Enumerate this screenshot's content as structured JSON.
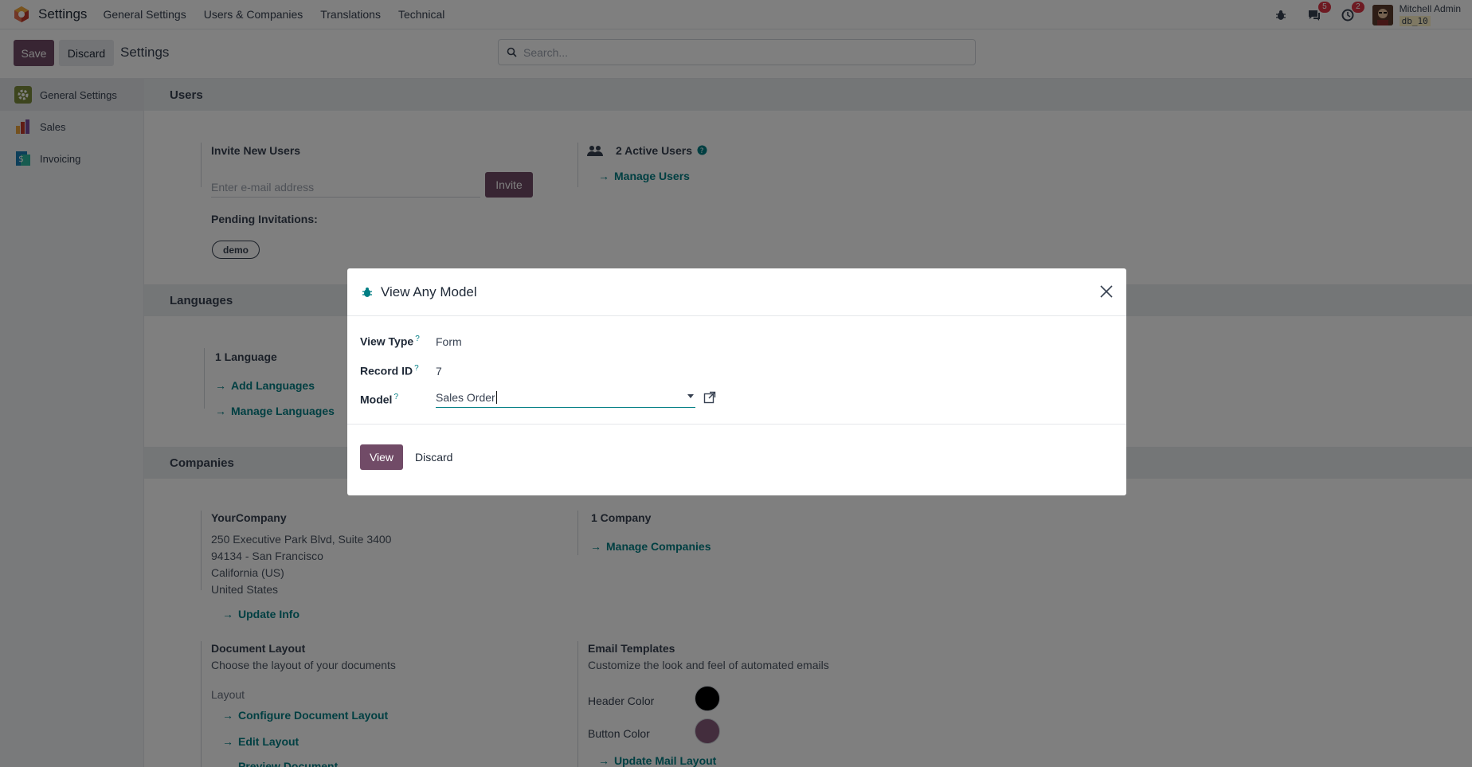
{
  "navbar": {
    "brand": "Settings",
    "menu": [
      "General Settings",
      "Users & Companies",
      "Translations",
      "Technical"
    ],
    "chat_count": "5",
    "activity_count": "2",
    "user_name": "Mitchell Admin",
    "db_name": "db_10"
  },
  "control": {
    "save_label": "Save",
    "discard_label": "Discard",
    "title": "Settings",
    "search_placeholder": "Search..."
  },
  "sidebar": {
    "items": [
      {
        "label": "General Settings",
        "icon": "settings-gear-icon"
      },
      {
        "label": "Sales",
        "icon": "sales-chart-icon"
      },
      {
        "label": "Invoicing",
        "icon": "invoicing-icon"
      }
    ]
  },
  "users": {
    "section": "Users",
    "invite_title": "Invite New Users",
    "email_placeholder": "Enter e-mail address",
    "invite_label": "Invite",
    "pending_label": "Pending Invitations:",
    "pending_user": "demo",
    "active_users": "2 Active Users",
    "manage_users": "Manage Users"
  },
  "languages": {
    "section": "Languages",
    "count": "1 Language",
    "add": "Add Languages",
    "manage": "Manage Languages"
  },
  "companies": {
    "section": "Companies",
    "company_name": "YourCompany",
    "address_1": "250 Executive Park Blvd, Suite 3400",
    "address_2": "94134 - San Francisco",
    "address_3": "California (US)",
    "address_4": "United States",
    "update_info": "Update Info",
    "count": "1 Company",
    "manage": "Manage Companies"
  },
  "document_layout": {
    "title": "Document Layout",
    "desc": "Choose the layout of your documents",
    "layout_label": "Layout",
    "configure": "Configure Document Layout",
    "edit": "Edit Layout",
    "preview": "Preview Document"
  },
  "email_templates": {
    "title": "Email Templates",
    "desc": "Customize the look and feel of automated emails",
    "header_color_label": "Header Color",
    "header_color": "#000000",
    "button_color_label": "Button Color",
    "button_color": "#875A7B",
    "update": "Update Mail Layout"
  },
  "modal": {
    "title": "View Any Model",
    "view_type_label": "View Type",
    "view_type": "Form",
    "record_id_label": "Record ID",
    "record_id": "7",
    "model_label": "Model",
    "model_value": "Sales Order",
    "help_mark": "?",
    "view_label": "View",
    "discard_label": "Discard"
  }
}
